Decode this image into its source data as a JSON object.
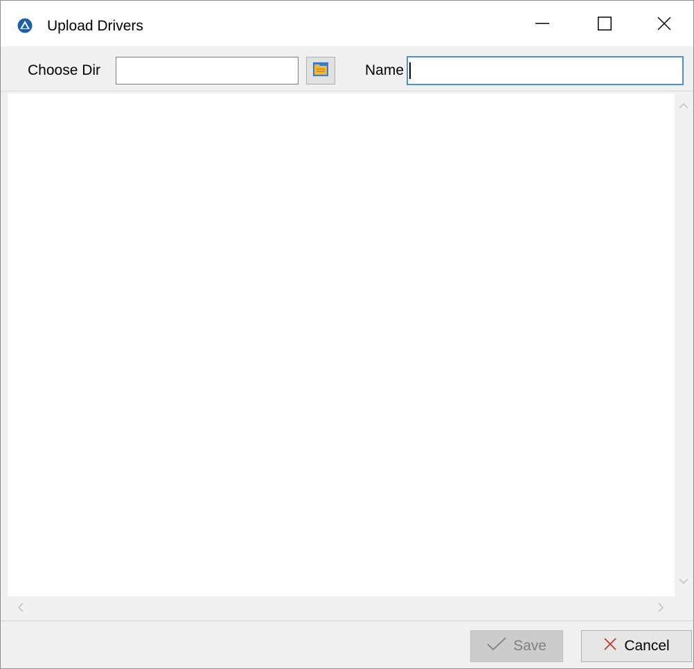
{
  "window": {
    "title": "Upload Drivers",
    "icon": "app-logo-icon",
    "controls": {
      "minimize": "minimize-icon",
      "maximize": "maximize-icon",
      "close": "close-icon"
    }
  },
  "toolbar": {
    "choose_dir_label": "Choose Dir",
    "choose_dir_value": "",
    "browse_icon": "folder-icon",
    "name_label": "Name",
    "name_value": ""
  },
  "footer": {
    "save_label": "Save",
    "save_icon": "checkmark-icon",
    "cancel_label": "Cancel",
    "cancel_icon": "x-icon"
  },
  "colors": {
    "focus_border": "#4a90d9",
    "app_icon": "#1f5fa8",
    "folder_icon": "#f2b53a",
    "cancel_x": "#c0392b",
    "disabled_text": "#808080"
  }
}
